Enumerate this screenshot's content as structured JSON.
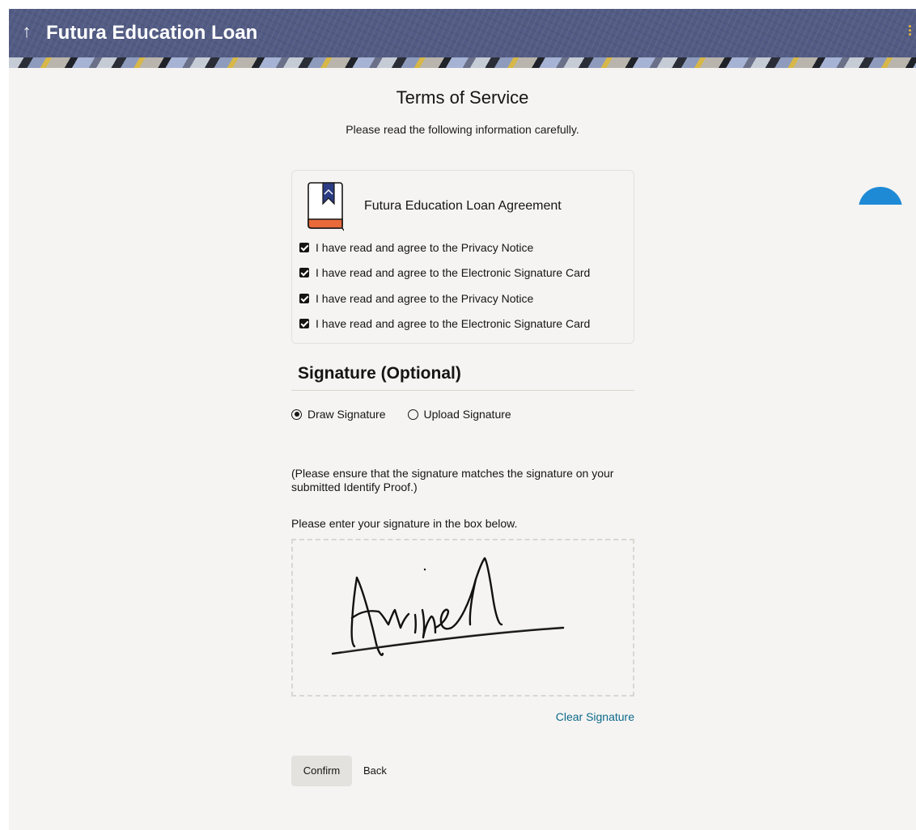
{
  "header": {
    "back_icon": "arrow-up-icon",
    "title": "Futura Education Loan",
    "menu_icon": "kebab-menu-icon"
  },
  "page": {
    "title": "Terms of Service",
    "subtitle": "Please read the following information carefully."
  },
  "agreement": {
    "icon": "book-icon",
    "title": "Futura Education Loan Agreement",
    "items": [
      {
        "label": "I have read and agree to the Privacy Notice",
        "checked": true
      },
      {
        "label": "I have read and agree to the Electronic Signature Card",
        "checked": true
      },
      {
        "label": "I have read and agree to the Privacy Notice",
        "checked": true
      },
      {
        "label": "I have read and agree to the Electronic Signature Card",
        "checked": true
      }
    ]
  },
  "signature": {
    "heading": "Signature (Optional)",
    "options": [
      {
        "label": "Draw Signature",
        "selected": true
      },
      {
        "label": "Upload Signature",
        "selected": false
      }
    ],
    "note": "(Please ensure that the signature matches the signature on your submitted Identify Proof.)",
    "prompt": "Please enter your signature in the box below.",
    "clear_label": "Clear Signature"
  },
  "actions": {
    "confirm_label": "Confirm",
    "back_label": "Back"
  },
  "colors": {
    "header_bg": "#525b83",
    "link": "#0d6a8a",
    "fab": "#1e8ad6",
    "book_accent": "#e8693a",
    "book_ribbon": "#2b3c84"
  }
}
